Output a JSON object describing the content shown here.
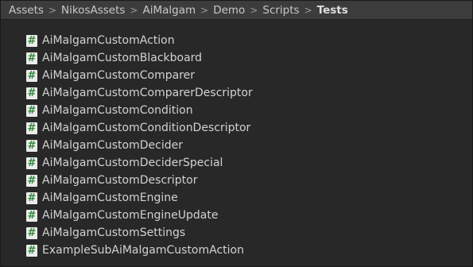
{
  "breadcrumb": {
    "items": [
      "Assets",
      "NikosAssets",
      "AiMalgam",
      "Demo",
      "Scripts",
      "Tests"
    ],
    "separator": ">"
  },
  "files": {
    "icon": "csharp-script-icon",
    "icon_glyph": "#",
    "icon_color": "#2f8a3a",
    "items": [
      "AiMalgamCustomAction",
      "AiMalgamCustomBlackboard",
      "AiMalgamCustomComparer",
      "AiMalgamCustomComparerDescriptor",
      "AiMalgamCustomCondition",
      "AiMalgamCustomConditionDescriptor",
      "AiMalgamCustomDecider",
      "AiMalgamCustomDeciderSpecial",
      "AiMalgamCustomDescriptor",
      "AiMalgamCustomEngine",
      "AiMalgamCustomEngineUpdate",
      "AiMalgamCustomSettings",
      "ExampleSubAiMalgamCustomAction"
    ]
  }
}
